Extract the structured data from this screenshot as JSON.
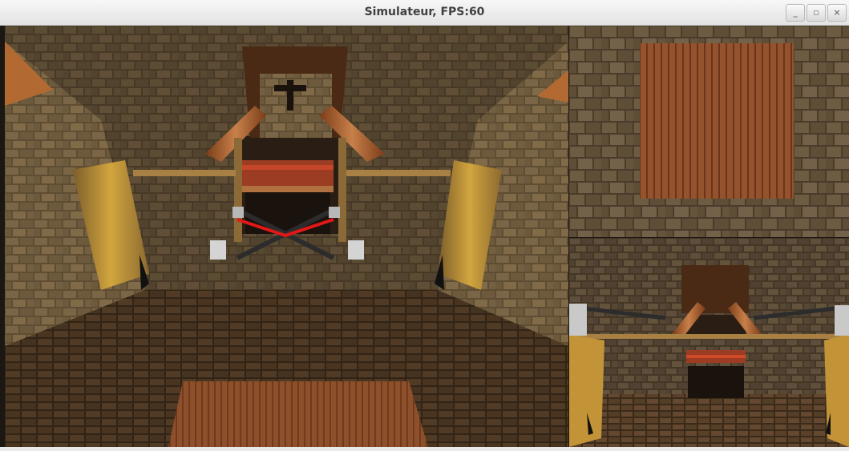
{
  "window": {
    "title": "Simulateur, FPS:60",
    "controls": {
      "minimize_icon": "minimize-icon",
      "maximize_icon": "maximize-icon",
      "close_icon": "close-icon",
      "minimize_glyph": "_",
      "maximize_glyph": "▫",
      "close_glyph": "×"
    }
  },
  "colors": {
    "wall_stone": "#6b5738",
    "floor_tile": "#5a4029",
    "wood": "#8a4c2a",
    "lit_wall": "#c79a3a",
    "drone_arm": "#2c2c2c",
    "drone_front": "#e01818",
    "lava": "#d04a2a"
  },
  "scene": {
    "main_view": "first-person camera",
    "top_view": "top-down camera",
    "rear_view": "third-person camera"
  }
}
